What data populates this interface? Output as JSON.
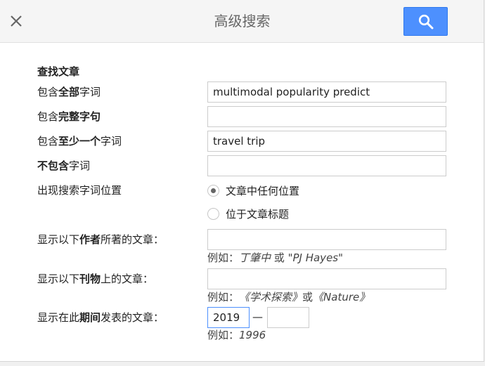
{
  "header": {
    "title": "高级搜索",
    "close_icon": "close-icon",
    "search_icon": "search-icon",
    "accent_color": "#4d90fe"
  },
  "form": {
    "section_title": "查找文章",
    "all_words": {
      "label_pre": "包含",
      "label_bold": "全部",
      "label_post": "字词",
      "value": "multimodal popularity predict"
    },
    "exact_phrase": {
      "label_pre": "包含",
      "label_bold": "完整字句",
      "label_post": "",
      "value": ""
    },
    "at_least_one": {
      "label_pre": "包含",
      "label_bold": "至少一个",
      "label_post": "字词",
      "value": "travel trip"
    },
    "without_words": {
      "label_pre": "",
      "label_bold": "不包含",
      "label_post": "字词",
      "value": ""
    },
    "occurrence": {
      "label": "出现搜索字词位置",
      "options": [
        "文章中任何位置",
        "位于文章标题"
      ],
      "selected": 0
    },
    "author": {
      "label_pre": "显示以下",
      "label_bold": "作者",
      "label_post": "所著的文章：",
      "value": "",
      "example_prefix": "例如：",
      "example_a": "丁肇中",
      "example_or": " 或 ",
      "example_b": "\"PJ Hayes\""
    },
    "publication": {
      "label_pre": "显示以下",
      "label_bold": "刊物",
      "label_post": "上的文章：",
      "value": "",
      "example_prefix": "例如：",
      "example_a": "《学术探索》",
      "example_or": "或",
      "example_b": "《Nature》"
    },
    "date": {
      "label_pre": "显示在此",
      "label_bold": "期间",
      "label_post": "发表的文章：",
      "from": "2019",
      "separator": "—",
      "to": "",
      "example_prefix": "例如：",
      "example_value": "1996"
    }
  }
}
